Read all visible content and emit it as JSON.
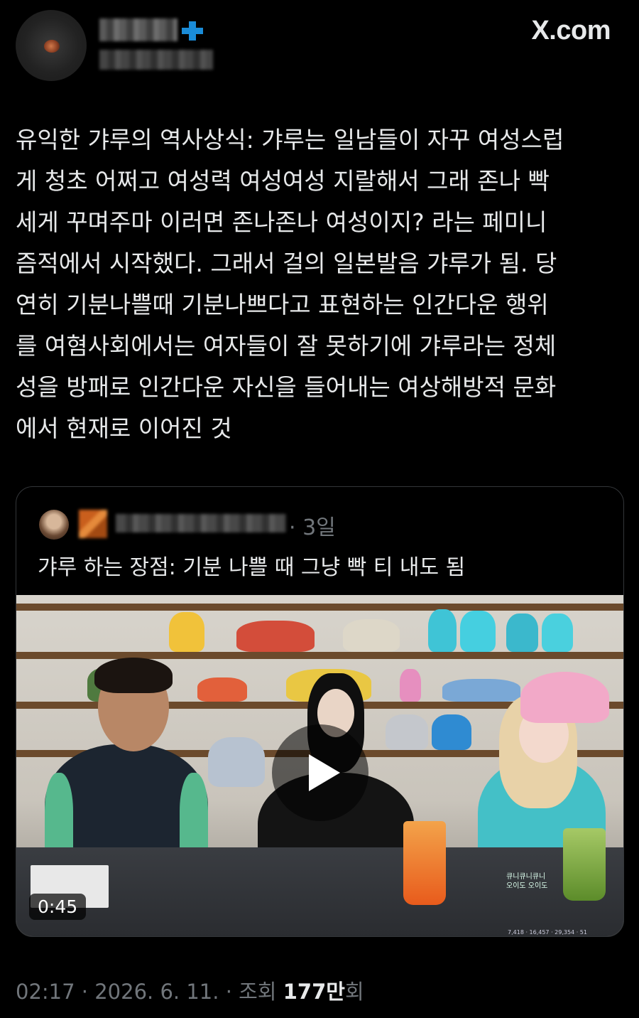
{
  "brand": "X.com",
  "tweet": {
    "lines": [
      "유익한 갸루의 역사상식: 갸루는 일남들이 자꾸 여성스럽",
      "게 청초 어쩌고 여성력 여성여성 지랄해서 그래 존나 빡",
      "세게 꾸며주마 이러면 존나존나 여성이지? 라는 페미니",
      "즘적에서 시작했다. 그래서 걸의 일본발음 갸루가 됨. 당",
      "연히 기분나쁠때 기분나쁘다고 표현하는 인간다운 행위",
      "를 여혐사회에서는 여자들이 잘 못하기에 갸루라는 정체",
      "성을 방패로 인간다운 자신을 들어내는 여상해방적 문화",
      "에서 현재로 이어진 것"
    ]
  },
  "quote": {
    "time": "· 3일",
    "text": "갸루 하는 장점: 기분 나쁠 때 그냥 빡 티 내도 됨",
    "video": {
      "duration": "0:45",
      "overlay_line1": "큐니큐니큐니",
      "overlay_line2": "오이도 오이도",
      "stats": "7,418 · 16,457 · 29,354 · 51"
    }
  },
  "meta": {
    "datetime": "02:17 · 2026. 6. 11. · 조회 ",
    "views": "177만",
    "views_suffix": "회"
  },
  "icons": [
    "verified-badge-icon",
    "play-icon"
  ],
  "colors": {
    "accent": "#1d9bf0",
    "muted": "#71767b",
    "text": "#e7e9ea",
    "background": "#000000"
  }
}
